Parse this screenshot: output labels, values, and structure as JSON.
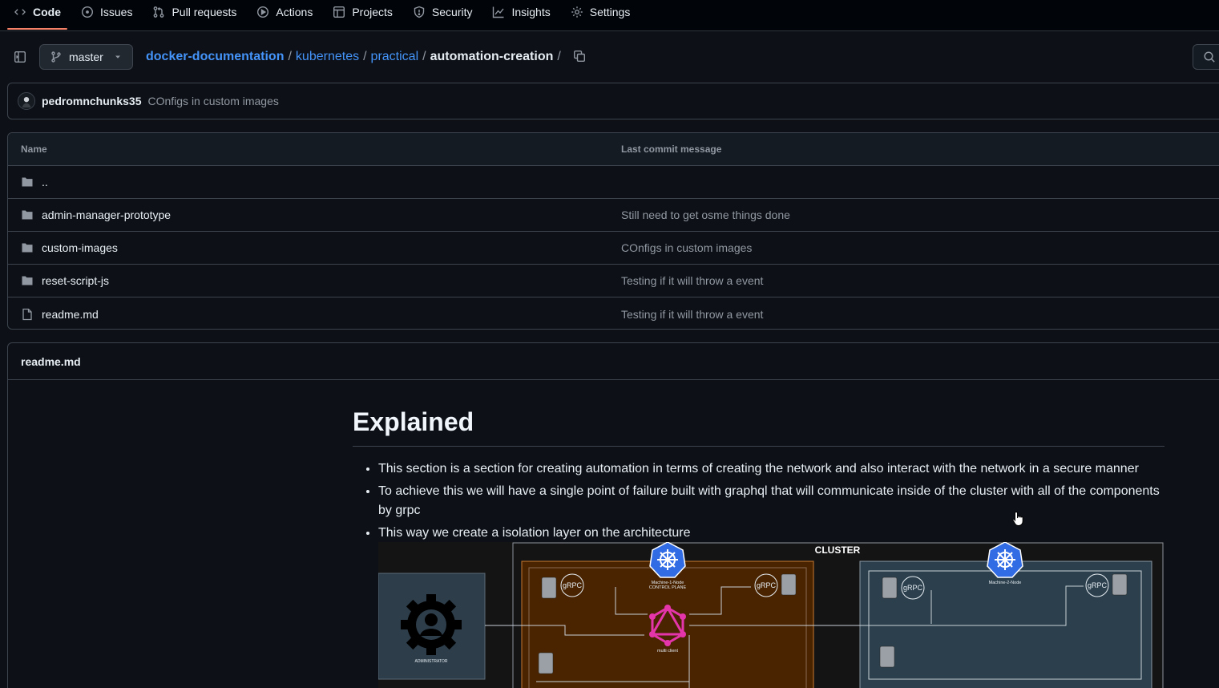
{
  "nav": {
    "tabs": [
      {
        "label": "Code",
        "icon": "code-icon",
        "selected": true
      },
      {
        "label": "Issues",
        "icon": "issue-opened-icon"
      },
      {
        "label": "Pull requests",
        "icon": "git-pull-request-icon"
      },
      {
        "label": "Actions",
        "icon": "play-icon"
      },
      {
        "label": "Projects",
        "icon": "table-icon"
      },
      {
        "label": "Security",
        "icon": "shield-icon"
      },
      {
        "label": "Insights",
        "icon": "graph-icon"
      },
      {
        "label": "Settings",
        "icon": "gear-icon"
      }
    ]
  },
  "header": {
    "branch": "master",
    "breadcrumb": {
      "repo": "docker-documentation",
      "parts": [
        "kubernetes",
        "practical"
      ],
      "current": "automation-creation",
      "separator": "/"
    }
  },
  "commit": {
    "author": "pedromnchunks35",
    "message": "COnfigs in custom images"
  },
  "table": {
    "col_name": "Name",
    "col_message": "Last commit message",
    "rows": [
      {
        "name": "..",
        "type": "folder",
        "message": ""
      },
      {
        "name": "admin-manager-prototype",
        "type": "folder",
        "message": "Still need to get osme things done"
      },
      {
        "name": "custom-images",
        "type": "folder",
        "message": "COnfigs in custom images"
      },
      {
        "name": "reset-script-js",
        "type": "folder",
        "message": "Testing if it will throw a event"
      },
      {
        "name": "readme.md",
        "type": "file",
        "message": "Testing if it will throw a event"
      }
    ]
  },
  "readme": {
    "filename": "readme.md",
    "heading": "Explained",
    "bullets": [
      "This section is a section for creating automation in terms of creating the network and also interact with the network in a secure manner",
      "To achieve this we will have a single point of failure built with graphql that will communicate inside of the cluster with all of the components by grpc",
      "This way we create a isolation layer on the architecture"
    ],
    "diagram": {
      "cluster_label": "CLUSTER",
      "admin_label": "ADMINISTRATOR",
      "node1_label_line1": "Machine-1-Node",
      "node1_label_line2": "CONTROL PLANE",
      "node2_label": "Machine-2-Node",
      "graphql_label": "multi client",
      "grpc": "gRPC"
    }
  },
  "colors": {
    "accent_link": "#4493f8",
    "selected_tab_underline": "#f78166",
    "graphql": "#e535ab",
    "kubernetes": "#326ce5"
  }
}
